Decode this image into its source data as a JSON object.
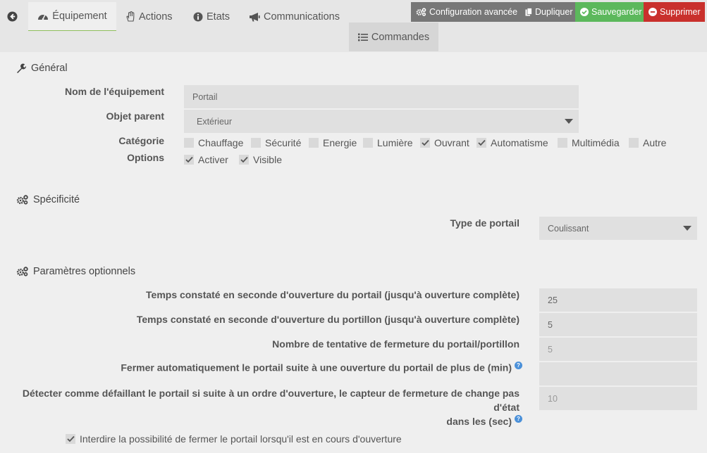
{
  "tabs": {
    "equipement": "Équipement",
    "actions": "Actions",
    "etats": "Etats",
    "communications": "Communications",
    "commandes": "Commandes"
  },
  "buttons": {
    "config": "Configuration avancée",
    "dupliquer": "Dupliquer",
    "sauvegarder": "Sauvegarder",
    "supprimer": "Supprimer"
  },
  "general": {
    "title": "Général",
    "name_label": "Nom de l'équipement",
    "name_value": "Portail",
    "parent_label": "Objet parent",
    "parent_value": "Extérieur",
    "category_label": "Catégorie",
    "categories": [
      {
        "label": "Chauffage",
        "checked": false
      },
      {
        "label": "Sécurité",
        "checked": false
      },
      {
        "label": "Energie",
        "checked": false
      },
      {
        "label": "Lumière",
        "checked": false
      },
      {
        "label": "Ouvrant",
        "checked": true
      },
      {
        "label": "Automatisme",
        "checked": true
      },
      {
        "label": "Multimédia",
        "checked": false
      },
      {
        "label": "Autre",
        "checked": false
      }
    ],
    "options_label": "Options",
    "options": [
      {
        "label": "Activer",
        "checked": true
      },
      {
        "label": "Visible",
        "checked": true
      }
    ]
  },
  "specificite": {
    "title": "Spécificité",
    "type_label": "Type de portail",
    "type_value": "Coulissant"
  },
  "params": {
    "title": "Paramètres optionnels",
    "items": [
      {
        "label": "Temps constaté en seconde d'ouverture du portail (jusqu'à ouverture complète)",
        "value": "25"
      },
      {
        "label": "Temps constaté en seconde d'ouverture du portillon (jusqu'à ouverture complète)",
        "value": "5"
      },
      {
        "label": "Nombre de tentative de fermeture du portail/portillon",
        "value": "5"
      },
      {
        "label": "Fermer automatiquement le portail suite à une ouverture du portail de plus de (min)",
        "value": ""
      },
      {
        "label_line1": "Détecter comme défaillant le portail si suite à un ordre d'ouverture, le capteur de fermeture de change pas d'état",
        "label_line2": "dans les (sec)",
        "value": "10"
      }
    ],
    "help_glyph": "?",
    "forbid_label": "Interdire la possibilité de fermer le portail lorsqu'il est en cours d'ouverture",
    "forbid_checked": true
  },
  "colors": {
    "save": "#5cb85c",
    "delete": "#c9302c",
    "neutral": "#777777",
    "tab_underline": "#8ebf5b"
  }
}
